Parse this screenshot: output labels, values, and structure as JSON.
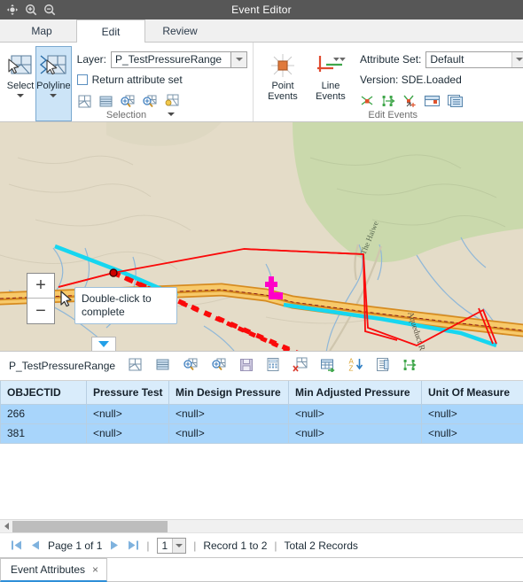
{
  "window": {
    "title": "Event Editor",
    "titlebar_icons": [
      "pan-icon",
      "zoom-in-icon",
      "zoom-out-icon"
    ]
  },
  "tabs": [
    {
      "label": "Map",
      "active": false
    },
    {
      "label": "Edit",
      "active": true
    },
    {
      "label": "Review",
      "active": false
    }
  ],
  "ribbon": {
    "selection_group": {
      "label": "Selection",
      "buttons": [
        {
          "label": "Select",
          "selected": false,
          "icon": "select-features-icon"
        },
        {
          "label": "Polyline",
          "selected": true,
          "icon": "polyline-select-icon"
        }
      ],
      "layer_label": "Layer:",
      "layer_value": "P_TestPressureRange",
      "return_attribute_set_label": "Return attribute set",
      "return_attribute_set_checked": false,
      "small_icons": [
        "clear-selection-icon",
        "list-selection-icon",
        "zoom-to-selection-icon",
        "pan-to-selection-icon",
        "selection-options-icon"
      ]
    },
    "edit_events_group": {
      "label": "Edit Events",
      "buttons": [
        {
          "label": "Point Events",
          "line1": "Point",
          "line2": "Events",
          "icon": "point-events-icon"
        },
        {
          "label": "Line Events",
          "line1": "Line",
          "line2": "Events",
          "icon": "line-events-icon"
        }
      ],
      "attribute_set_label": "Attribute Set:",
      "attribute_set_value": "Default",
      "version_label": "Version: SDE.Loaded",
      "small_icons": [
        "retire-event-icon",
        "extend-event-icon",
        "reassign-event-icon",
        "merge-event-icon",
        "copy-event-icon"
      ]
    }
  },
  "map": {
    "zoom_in_label": "+",
    "zoom_out_label": "−",
    "tooltip_text": "Double-click to complete",
    "labels": [
      {
        "text": "Aqueduct Rd"
      },
      {
        "text": "The Haiwe"
      }
    ],
    "collapse_icon": "collapse-chevron-icon",
    "cursor_icon": "mouse-pointer-icon",
    "colors": {
      "land": "#e4dcc8",
      "vegetation": "#c9d8ac",
      "road_fill": "#f7c96a",
      "road_casing": "#d68b20",
      "water": "#8fb7d8",
      "sketch_line": "#fa0a0a",
      "route_highlight": "#16d6f0",
      "event_marker": "#ff00c8"
    }
  },
  "table": {
    "name": "P_TestPressureRange",
    "toolbar_icons": [
      "clear-selection-icon",
      "list-fields-icon",
      "zoom-to-selected-icon",
      "pan-to-selected-icon",
      "save-icon",
      "calculator-icon",
      "delete-selected-icon",
      "add-row-icon",
      "sort-ascending-icon",
      "field-properties-icon",
      "measure-icon"
    ],
    "columns": [
      "OBJECTID",
      "Pressure Test",
      "Min Design Pressure",
      "Min Adjusted Pressure",
      "Unit Of Measure"
    ],
    "rows": [
      {
        "selected": true,
        "cells": [
          "266",
          "<null>",
          "<null>",
          "<null>",
          "<null>"
        ]
      },
      {
        "selected": true,
        "cells": [
          "381",
          "<null>",
          "<null>",
          "<null>",
          "<null>"
        ]
      }
    ]
  },
  "pager": {
    "first_icon": "first-page-icon",
    "prev_icon": "previous-page-icon",
    "page_text": "Page 1 of 1",
    "next_icon": "next-page-icon",
    "last_icon": "last-page-icon",
    "separator": "|",
    "page_size_value": "1",
    "record_range": "Record 1 to 2",
    "total_records": "Total 2 Records"
  },
  "bottom_tabs": [
    {
      "label": "Event Attributes",
      "close": "×",
      "active": true
    }
  ]
}
